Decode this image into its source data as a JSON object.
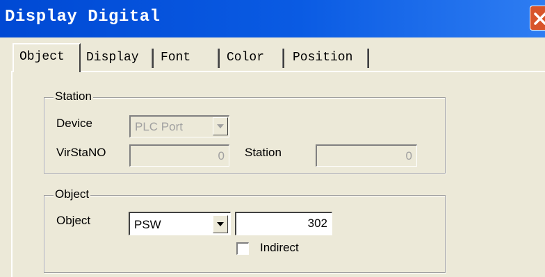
{
  "window": {
    "title": "Display Digital"
  },
  "tabs": [
    "Object",
    "Display",
    "Font",
    "Color",
    "Position"
  ],
  "station_group": {
    "legend": "Station",
    "device_label": "Device",
    "device_value": "PLC Port",
    "virstano_label": "VirStaNO",
    "virstano_value": "0",
    "station_label": "Station",
    "station_value": "0"
  },
  "object_group": {
    "legend": "Object",
    "object_label": "Object",
    "object_type": "PSW",
    "object_address": "302",
    "indirect_label": "Indirect",
    "indirect_checked": false
  },
  "colors": {
    "titlebar": "#0a5be3",
    "close": "#d8542a",
    "dialog": "#ece9d8"
  }
}
